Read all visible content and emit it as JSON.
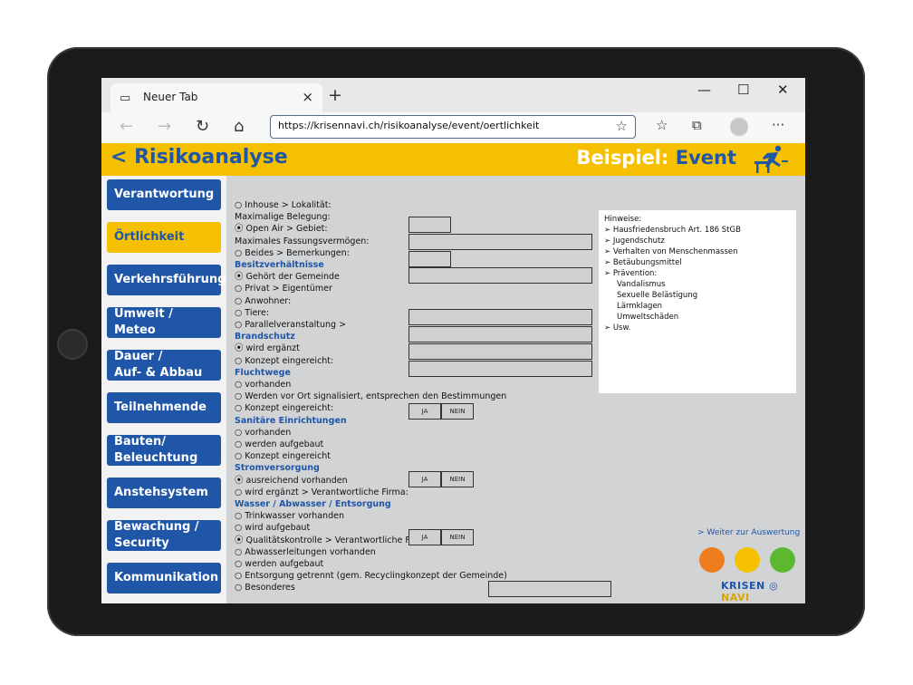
{
  "browser": {
    "tab_title": "Neuer Tab",
    "tab_close": "×",
    "new_tab": "+",
    "minimize": "—",
    "maximize": "☐",
    "close": "✕",
    "url": "https://krisennavi.ch/risikoanalyse/event/oertlichkeit",
    "icons": [
      "tab-page-icon",
      "back-icon",
      "forward-icon",
      "refresh-icon",
      "home-icon",
      "star-icon",
      "favorites-icon",
      "collections-icon",
      "profile-icon",
      "more-icon"
    ]
  },
  "header": {
    "back_title": "< Risikoanalyse",
    "example_label": "Beispiel:",
    "example_value": "Event"
  },
  "sidebar": {
    "items": [
      {
        "label": "Verantwortung"
      },
      {
        "label": "Örtlichkeit"
      },
      {
        "label": "Verkehrsführung"
      },
      {
        "label": "Umwelt / Meteo"
      },
      {
        "label": "Dauer /\nAuf- & Abbau"
      },
      {
        "label": "Teilnehmende"
      },
      {
        "label": "Bauten/\nBeleuchtung"
      },
      {
        "label": "Anstehsystem"
      },
      {
        "label": "Bewachung /\nSecurity"
      },
      {
        "label": "Kommunikation"
      }
    ],
    "active": "Örtlichkeit"
  },
  "form": {
    "rows": [
      "○ Inhouse > Lokalität:",
      "Maximalige Belegung:",
      "⦿ Open Air > Gebiet:",
      "Maximales Fassungsvermögen:",
      "○ Beides > Bemerkungen:",
      "Besitzverhältnisse",
      "⦿ Gehört der Gemeinde",
      "○ Privat > Eigentümer",
      "○ Anwohner:",
      "○ Tiere:",
      "○ Parallelveranstaltung >",
      "Brandschutz",
      "⦿ wird ergänzt",
      "○ Konzept eingereicht:",
      "Fluchtwege",
      "○ vorhanden",
      "○ Werden vor Ort signalisiert, entsprechen den Bestimmungen",
      "○ Konzept eingereicht:",
      "Sanitäre Einrichtungen",
      "○ vorhanden",
      "○ werden aufgebaut",
      "○ Konzept eingereicht",
      "Stromversorgung",
      "⦿ ausreichend vorhanden",
      "○ wird ergänzt > Verantwortliche Firma:",
      "Wasser / Abwasser / Entsorgung",
      "○ Trinkwasser vorhanden",
      "○ wird aufgebaut",
      "⦿ Qualitätskontrolle > Verantwortliche Firma:",
      "○ Abwasserleitungen vorhanden",
      "○ werden aufgebaut",
      "○ Entsorgung getrennt (gem. Recyclingkonzept der Gemeinde)",
      "○ Besonderes"
    ],
    "yes_label": "JA",
    "no_label": "NEIN"
  },
  "hints": {
    "title": "Hinweise:",
    "items": [
      "➢  Hausfriedensbruch Art. 186 StGB",
      "➢  Jugendschutz",
      "➢  Verhalten von Menschenmassen",
      "➢  Betäubungsmittel",
      "➢  Prävention:"
    ],
    "sub_items": [
      "Vandalismus",
      "Sexuelle Belästigung",
      "Lärmklagen",
      "Umweltschäden"
    ],
    "last": "➢  Usw."
  },
  "footer": {
    "next_link": "> Weiter zur Auswertung",
    "logo_left": "KRISEN",
    "logo_right": "NAVI",
    "lights": [
      "#ee7d1f",
      "#f5c000",
      "#5cb82e"
    ]
  }
}
